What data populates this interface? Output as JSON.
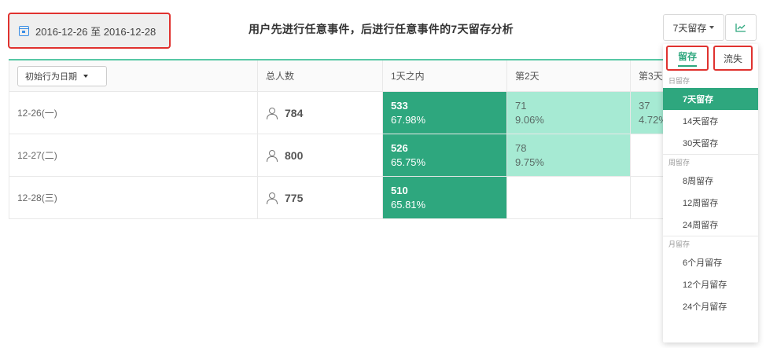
{
  "toolbar": {
    "date_range": "2016-12-26 至 2016-12-28",
    "title": "用户先进行任意事件，后进行任意事件的7天留存分析",
    "period_select": "7天留存"
  },
  "table": {
    "headers": {
      "date_select": "初始行为日期",
      "total": "总人数",
      "col1": "1天之内",
      "col2": "第2天",
      "col3": "第3天"
    },
    "rows": [
      {
        "date": "12-26(一)",
        "total": "784",
        "c1_n": "533",
        "c1_p": "67.98%",
        "c2_n": "71",
        "c2_p": "9.06%",
        "c3_n": "37",
        "c3_p": "4.72%"
      },
      {
        "date": "12-27(二)",
        "total": "800",
        "c1_n": "526",
        "c1_p": "65.75%",
        "c2_n": "78",
        "c2_p": "9.75%"
      },
      {
        "date": "12-28(三)",
        "total": "775",
        "c1_n": "510",
        "c1_p": "65.81%"
      }
    ]
  },
  "dropdown": {
    "tab_retention": "留存",
    "tab_churn": "流失",
    "groups": [
      {
        "label": "日留存",
        "options": [
          "7天留存",
          "14天留存",
          "30天留存"
        ]
      },
      {
        "label": "周留存",
        "options": [
          "8周留存",
          "12周留存",
          "24周留存"
        ]
      },
      {
        "label": "月留存",
        "options": [
          "6个月留存",
          "12个月留存",
          "24个月留存"
        ]
      }
    ],
    "selected": "7天留存"
  },
  "colors": {
    "accent": "#2ea77e",
    "light_cell": "#a6ead3",
    "highlight_border": "#e0322f"
  },
  "icons": {
    "date_range": "calendar-icon",
    "chart_button": "line-chart-icon",
    "total": "person-icon"
  }
}
